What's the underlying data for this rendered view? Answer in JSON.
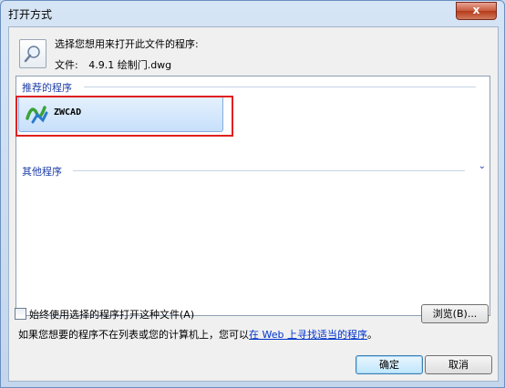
{
  "window": {
    "title": "打开方式",
    "close_glyph": "x"
  },
  "header": {
    "prompt": "选择您想用来打开此文件的程序:",
    "file_label": "文件:",
    "file_name": "4.9.1 绘制门.dwg"
  },
  "list": {
    "recommended_label": "推荐的程序",
    "other_label": "其他程序",
    "expander_glyph": "⌄",
    "programs": [
      {
        "name": "ZWCAD"
      }
    ]
  },
  "footer": {
    "always_use_label": "始终使用选择的程序打开这种文件(A)",
    "always_use_checked": false,
    "browse_label": "浏览(B)...",
    "hint_prefix": "如果您想要的程序不在列表或您的计算机上，您可以",
    "hint_link": "在 Web 上寻找适当的程序",
    "hint_suffix": "。",
    "ok_label": "确定",
    "cancel_label": "取消"
  },
  "colors": {
    "group_text": "#1e3fa8",
    "highlight_border": "#e02020",
    "link": "#0033cc"
  }
}
